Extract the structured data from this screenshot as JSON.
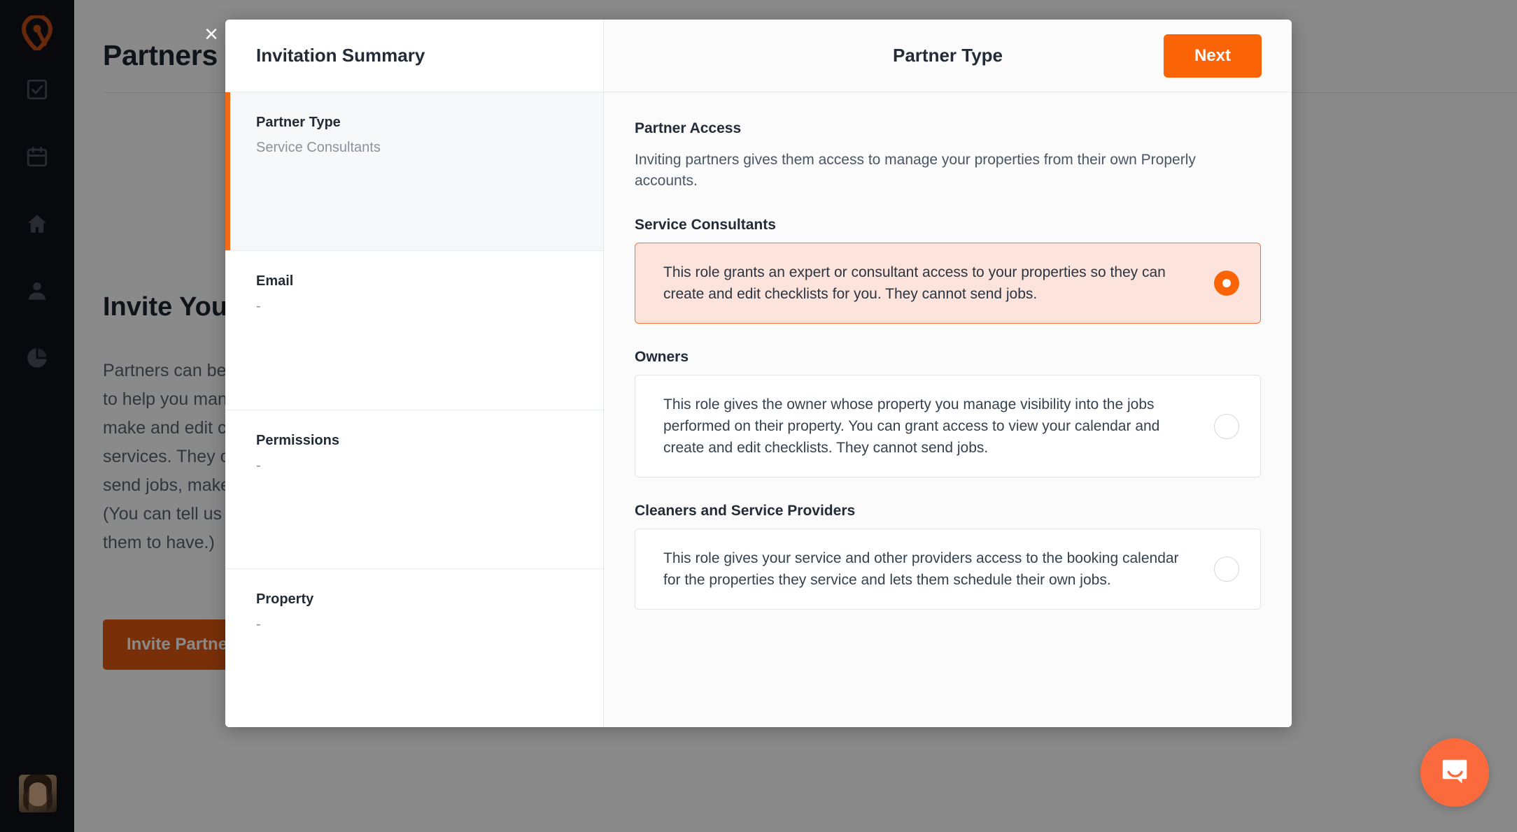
{
  "sidebar": {
    "logo": "properly-pin-logo",
    "items": [
      {
        "icon": "checklist-icon",
        "name": "checklists"
      },
      {
        "icon": "calendar-icon",
        "name": "calendar"
      },
      {
        "icon": "home-icon",
        "name": "properties"
      },
      {
        "icon": "person-icon",
        "name": "partners"
      },
      {
        "icon": "pie-chart-icon",
        "name": "reports"
      }
    ],
    "avatar_alt": "user-avatar"
  },
  "background_page": {
    "title": "Partners",
    "section_heading": "Invite Your Partners",
    "body": "Partners can be owners, property managers, cleaning companies or service consultants you invite\nto help you manage your properties, send jobs,\nmake and edit checklists, or perform cleaning\nservices. They can have access to your calendar,\nsend jobs, make checklists and receive jobs.\n(You can tell us what access you would like\nthem to have.)",
    "invite_button": "Invite Partner"
  },
  "modal": {
    "close_label": "×",
    "summary": {
      "heading": "Invitation Summary",
      "steps": [
        {
          "label": "Partner Type",
          "value": "Service Consultants",
          "active": true
        },
        {
          "label": "Email",
          "value": "-",
          "active": false
        },
        {
          "label": "Permissions",
          "value": "-",
          "active": false
        },
        {
          "label": "Property",
          "value": "-",
          "active": false
        }
      ]
    },
    "panel": {
      "title": "Partner Type",
      "next_button": "Next",
      "section_title": "Partner Access",
      "section_desc": "Inviting partners gives them access to manage your properties from their own Properly accounts.",
      "options": [
        {
          "group": "Service Consultants",
          "description": "This role grants an expert or consultant access to your properties so they can create and edit checklists for you. They cannot send jobs.",
          "selected": true
        },
        {
          "group": "Owners",
          "description": "This role gives the owner whose property you manage visibility into the jobs performed on their property. You can grant access to view your calendar and create and edit checklists. They cannot send jobs.",
          "selected": false
        },
        {
          "group": "Cleaners and Service Providers",
          "description": "This role gives your service and other providers access to the booking calendar for the properties they service and lets them schedule their own jobs.",
          "selected": false
        }
      ]
    }
  },
  "intercom": {
    "icon": "chat-bubble-icon"
  },
  "colors": {
    "brand_orange": "#fb6307",
    "logo_orange": "#c04a15",
    "invite_button": "#e0590f",
    "selected_card_bg": "#fce4dc",
    "selected_card_border": "#f47341",
    "sidebar_bg": "#0d1117",
    "overlay": "rgba(0,0,0,0.46)"
  }
}
